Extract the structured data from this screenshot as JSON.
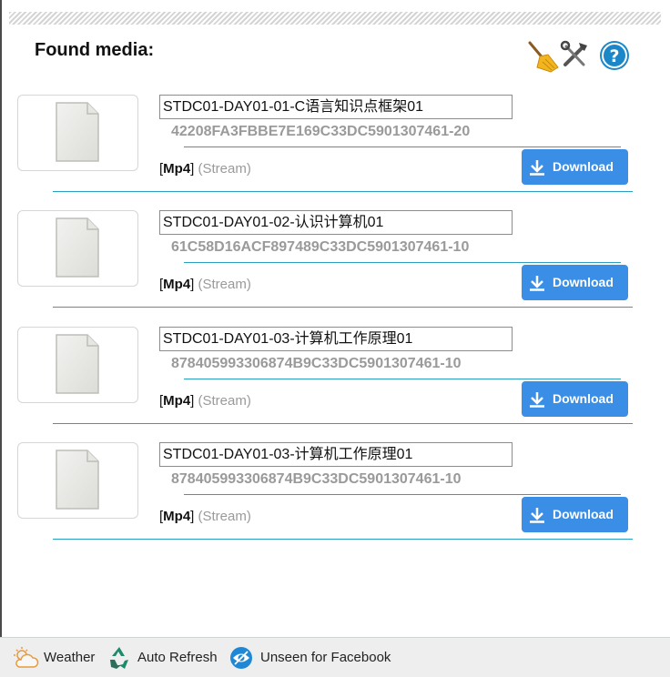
{
  "header": {
    "title": "Found media:"
  },
  "toolbar": {
    "icons": [
      "broom-icon",
      "tools-icon",
      "help-icon"
    ]
  },
  "media": [
    {
      "name": "STDC01-DAY01-01-C语言知识点框架01",
      "hash": "42208FA3FBBE7E169C33DC5901307461-20",
      "format": "Mp4",
      "stream": "(Stream)",
      "download_label": "Download"
    },
    {
      "name": "STDC01-DAY01-02-认识计算机01",
      "hash": "61C58D16ACF897489C33DC5901307461-10",
      "format": "Mp4",
      "stream": "(Stream)",
      "download_label": "Download"
    },
    {
      "name": "STDC01-DAY01-03-计算机工作原理01",
      "hash": "878405993306874B9C33DC5901307461-10",
      "format": "Mp4",
      "stream": "(Stream)",
      "download_label": "Download"
    },
    {
      "name": "STDC01-DAY01-03-计算机工作原理01",
      "hash": "878405993306874B9C33DC5901307461-10",
      "format": "Mp4",
      "stream": "(Stream)",
      "download_label": "Download"
    }
  ],
  "footer": {
    "weather": "Weather",
    "auto_refresh": "Auto Refresh",
    "unseen": "Unseen for Facebook"
  },
  "colors": {
    "accent": "#3a8ee6",
    "divider": "#2a9fc0"
  }
}
